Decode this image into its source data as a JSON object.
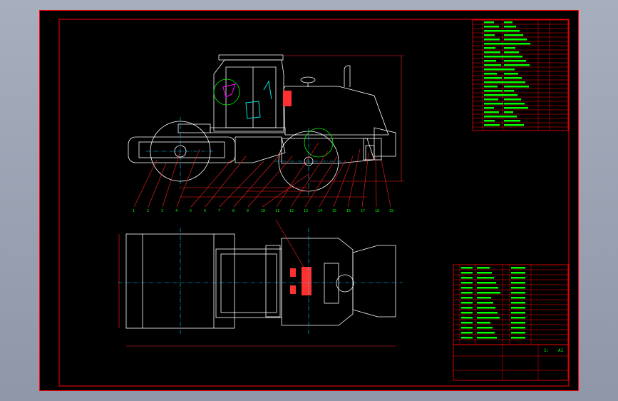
{
  "colors": {
    "background": "#000000",
    "frame": "#ff0000",
    "outline": "#ffffff",
    "dimension": "#ff2020",
    "centerline": "#00d0ff",
    "text": "#00ff00",
    "cab_detail": "#ff00ff",
    "seat": "#00e0e0"
  },
  "side_view": {
    "leader_labels": [
      "1",
      "2",
      "3",
      "4",
      "5",
      "6",
      "7",
      "8",
      "9",
      "10",
      "11",
      "12",
      "13",
      "14",
      "15",
      "16",
      "17",
      "18",
      "19"
    ]
  },
  "title_block": {
    "scale": "1:",
    "sheet": "A1"
  }
}
